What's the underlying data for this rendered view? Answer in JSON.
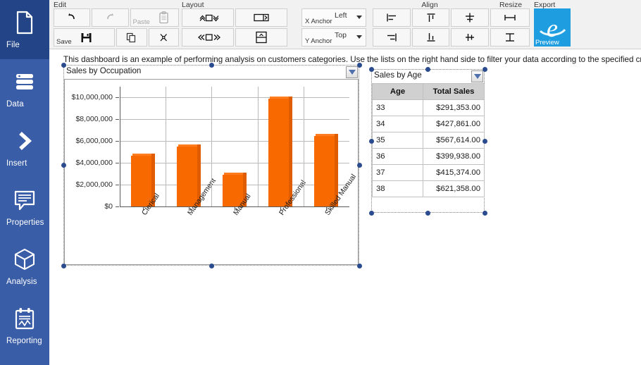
{
  "sidebar": {
    "items": [
      {
        "label": "File",
        "icon": "file-icon",
        "active": true
      },
      {
        "label": "Data",
        "icon": "database-icon",
        "active": false
      },
      {
        "label": "Insert",
        "icon": "chevron-right-icon",
        "active": false
      },
      {
        "label": "Properties",
        "icon": "comment-lines-icon",
        "active": false
      },
      {
        "label": "Analysis",
        "icon": "cube-icon",
        "active": false
      },
      {
        "label": "Reporting",
        "icon": "clipboard-chart-icon",
        "active": false
      }
    ],
    "colors": {
      "background": "#3A5DA8",
      "active_background": "#234588",
      "text": "#FFFFFF"
    }
  },
  "ribbon": {
    "groups": [
      {
        "title": "Edit",
        "buttons": [
          {
            "name": "undo-button",
            "label": "",
            "icon": "undo-arrow-icon",
            "enabled": true
          },
          {
            "name": "redo-button",
            "label": "",
            "icon": "redo-arrow-icon",
            "enabled": false
          },
          {
            "name": "paste-button",
            "label": "Paste",
            "icon": "clipboard-icon",
            "enabled": false
          },
          {
            "name": "save-button",
            "label": "Save",
            "icon": "floppy-disk-icon",
            "enabled": true
          },
          {
            "name": "copy-button",
            "label": "",
            "icon": "copy-pages-icon",
            "enabled": true
          },
          {
            "name": "cut-button",
            "label": "",
            "icon": "scissors-icon",
            "enabled": true
          }
        ]
      },
      {
        "title": "Layout",
        "buttons": [
          {
            "name": "bring-forward-button",
            "label": "",
            "icon": "move-vertical-icon"
          },
          {
            "name": "send-backward-button",
            "label": "",
            "icon": "move-horizontal-icon"
          },
          {
            "name": "dock-right-button",
            "label": "",
            "icon": "dock-right-icon"
          },
          {
            "name": "dock-top-button",
            "label": "",
            "icon": "dock-top-icon"
          }
        ],
        "combos": [
          {
            "name": "x-anchor-select",
            "label": "X Anchor",
            "value": "Left"
          },
          {
            "name": "y-anchor-select",
            "label": "Y Anchor",
            "value": "Top"
          }
        ]
      },
      {
        "title": "Align",
        "buttons": [
          {
            "name": "align-left-button",
            "label": "",
            "icon": "align-left-icon"
          },
          {
            "name": "align-top-button",
            "label": "",
            "icon": "align-top-icon"
          },
          {
            "name": "align-center-horizontal-button",
            "label": "",
            "icon": "align-center-h-icon"
          },
          {
            "name": "align-right-button",
            "label": "",
            "icon": "align-right-icon"
          },
          {
            "name": "align-bottom-button",
            "label": "",
            "icon": "align-bottom-icon"
          },
          {
            "name": "align-center-vertical-button",
            "label": "",
            "icon": "align-center-v-icon"
          }
        ]
      },
      {
        "title": "Resize",
        "buttons": [
          {
            "name": "resize-width-button",
            "label": "",
            "icon": "resize-width-icon"
          },
          {
            "name": "resize-height-button",
            "label": "",
            "icon": "resize-height-icon"
          }
        ]
      },
      {
        "title": "Export",
        "buttons": [
          {
            "name": "preview-button",
            "label": "Preview",
            "icon": "internet-explorer-icon",
            "color": "#1E9EE0"
          }
        ]
      }
    ]
  },
  "canvas": {
    "description": "This dashboard is an example of performing analysis on customers categories. Use the lists on the right hand side to filter your data according to the specified criteria.",
    "chart_widget": {
      "title": "Sales by Occupation",
      "dropdown_icon": "filter-dropdown-icon",
      "selected": true
    },
    "table_widget": {
      "title": "Sales by Age",
      "dropdown_icon": "filter-dropdown-icon",
      "selected": true
    }
  },
  "chart_data": {
    "type": "bar",
    "title": "Sales by Occupation",
    "xlabel": "",
    "ylabel": "",
    "categories": [
      "Clerical",
      "Management",
      "Manual",
      "Professional",
      "Skilled Manual"
    ],
    "values": [
      4650000,
      5500000,
      2900000,
      9900000,
      6450000
    ],
    "ylim": [
      0,
      11000000
    ],
    "yticks": [
      0,
      2000000,
      4000000,
      6000000,
      8000000,
      10000000
    ],
    "ytick_labels": [
      "$0",
      "$2,000,000",
      "$4,000,000",
      "$6,000,000",
      "$8,000,000",
      "$10,000,000"
    ],
    "grid": true,
    "legend": false,
    "bar_color": "#F86800"
  },
  "table_data": {
    "type": "table",
    "title": "Sales by Age",
    "columns": [
      "Age",
      "Total Sales"
    ],
    "rows": [
      [
        "33",
        "$291,353.00"
      ],
      [
        "34",
        "$427,861.00"
      ],
      [
        "35",
        "$567,614.00"
      ],
      [
        "36",
        "$399,938.00"
      ],
      [
        "37",
        "$415,374.00"
      ],
      [
        "38",
        "$621,358.00"
      ]
    ]
  }
}
